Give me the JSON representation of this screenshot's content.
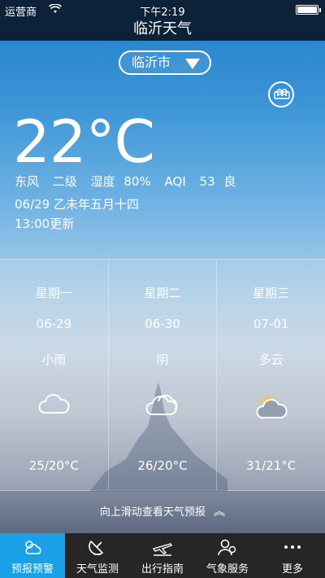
{
  "status_bar": {
    "carrier": "运营商",
    "time": "下午2:19"
  },
  "app": {
    "title": "临沂天气"
  },
  "city": {
    "name": "临沂市"
  },
  "current": {
    "temperature": "22°C",
    "wind_dir": "东风",
    "wind_level": "二级",
    "humidity_label": "湿度",
    "humidity_value": "80%",
    "aqi_label": "AQI",
    "aqi_value": "53",
    "aqi_quality": "良",
    "date_line": "06/29 乙未年五月十四",
    "update_time": "13:00更新"
  },
  "forecast": [
    {
      "weekday": "星期一",
      "date": "06-29",
      "condition": "小雨",
      "icon": "light-rain-icon",
      "range": "25/20°C"
    },
    {
      "weekday": "星期二",
      "date": "06-30",
      "condition": "阴",
      "icon": "overcast-icon",
      "range": "26/20°C"
    },
    {
      "weekday": "星期三",
      "date": "07-01",
      "condition": "多云",
      "icon": "partly-cloudy-icon",
      "range": "31/21°C"
    }
  ],
  "hint": "向上滑动查看天气预报",
  "nav": [
    {
      "label": "预报预警",
      "icon": "forecast-icon",
      "active": true
    },
    {
      "label": "天气监测",
      "icon": "radar-icon",
      "active": false
    },
    {
      "label": "出行指南",
      "icon": "plane-icon",
      "active": false
    },
    {
      "label": "气象服务",
      "icon": "service-icon",
      "active": false
    },
    {
      "label": "更多",
      "icon": "more-icon",
      "active": false
    }
  ],
  "colors": {
    "nav_active": "#1aa0e6",
    "nav_bg": "#262626",
    "header_bg": "#0d2238"
  }
}
